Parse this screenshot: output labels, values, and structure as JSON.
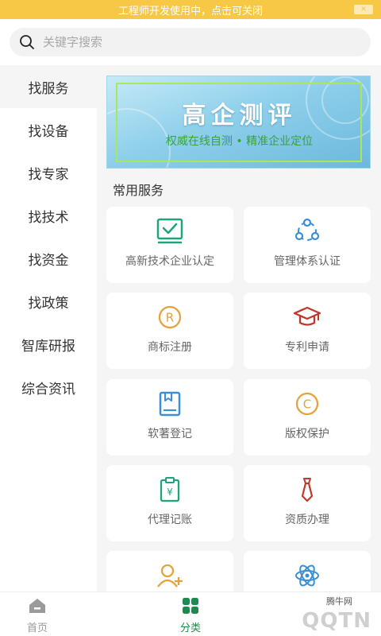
{
  "dev_bar": {
    "text": "工程师开发使用中，点击可关闭"
  },
  "search": {
    "placeholder": "关键字搜索"
  },
  "sidebar": {
    "items": [
      {
        "label": "找服务",
        "active": true
      },
      {
        "label": "找设备"
      },
      {
        "label": "找专家"
      },
      {
        "label": "找技术"
      },
      {
        "label": "找资金"
      },
      {
        "label": "找政策"
      },
      {
        "label": "智库研报"
      },
      {
        "label": "综合资讯"
      }
    ]
  },
  "banner": {
    "title": "高企测评",
    "subtitle": "权威在线自测 • 精准企业定位"
  },
  "section": {
    "title": "常用服务"
  },
  "services": [
    {
      "label": "高新技术企业认定",
      "icon": "certificate-check-icon",
      "color": "#1fa37a"
    },
    {
      "label": "管理体系认证",
      "icon": "system-nodes-icon",
      "color": "#3a8fd6"
    },
    {
      "label": "商标注册",
      "icon": "registered-icon",
      "color": "#e6a23c"
    },
    {
      "label": "专利申请",
      "icon": "graduation-cap-icon",
      "color": "#c0392b"
    },
    {
      "label": "软著登记",
      "icon": "book-icon",
      "color": "#3a8fd6"
    },
    {
      "label": "版权保护",
      "icon": "copyright-icon",
      "color": "#e6a23c"
    },
    {
      "label": "代理记账",
      "icon": "accounting-clipboard-icon",
      "color": "#1fa37a"
    },
    {
      "label": "资质办理",
      "icon": "tie-icon",
      "color": "#c0392b"
    },
    {
      "label": "",
      "icon": "add-user-icon",
      "color": "#e6a23c"
    },
    {
      "label": "",
      "icon": "atom-icon",
      "color": "#3a8fd6"
    }
  ],
  "bottom_nav": [
    {
      "label": "首页",
      "icon": "home-icon",
      "active": false
    },
    {
      "label": "分类",
      "icon": "category-grid-icon",
      "active": true
    }
  ],
  "watermark": {
    "text": "腾牛网",
    "logo": "QQTN"
  },
  "colors": {
    "accent": "#1f8a4f",
    "dev_bar": "#f7c746"
  }
}
